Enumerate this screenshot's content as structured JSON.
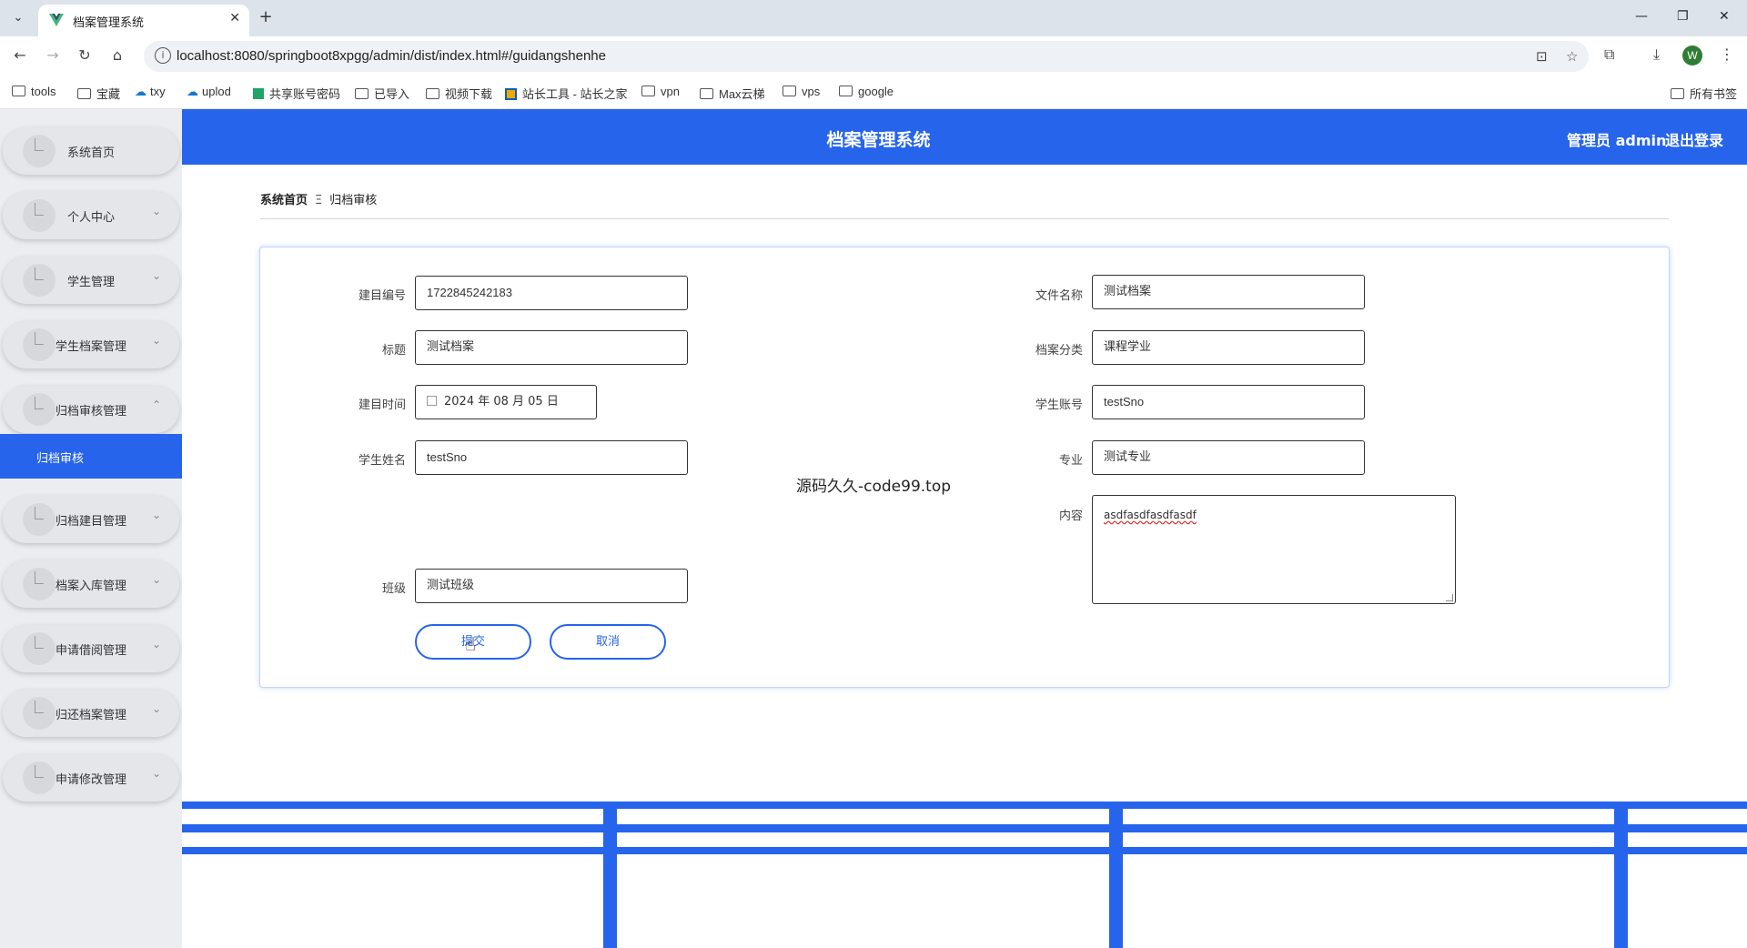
{
  "browser": {
    "tab_title": "档案管理系统",
    "url": "localhost:8080/springboot8xpgg/admin/dist/index.html#/guidangshenhe",
    "profile_initial": "W",
    "bookmarks": [
      "tools",
      "宝藏",
      "txy",
      "uplod",
      "共享账号密码",
      "已导入",
      "视频下载",
      "站长工具 - 站长之家",
      "vpn",
      "Max云梯",
      "vps",
      "google"
    ],
    "all_bookmarks": "所有书签"
  },
  "header": {
    "title": "档案管理系统",
    "admin_label": "管理员 admin",
    "logout_label": "退出登录"
  },
  "sidebar": {
    "items": [
      "系统首页",
      "个人中心",
      "学生管理",
      "学生档案管理",
      "归档审核管理",
      "归档建目管理",
      "档案入库管理",
      "申请借阅管理",
      "归还档案管理",
      "申请修改管理"
    ],
    "active_sub": "归档审核"
  },
  "breadcrumb": {
    "home": "系统首页",
    "separator": "Ξ",
    "current": "归档审核"
  },
  "form": {
    "catalog_no_label": "建目编号",
    "catalog_no": "1722845242183",
    "title_label": "标题",
    "title": "测试档案",
    "catalog_time_label": "建目时间",
    "catalog_time": "2024 年 08 月 05 日",
    "student_name_label": "学生姓名",
    "student_name": "testSno",
    "class_label": "班级",
    "class": "测试班级",
    "file_name_label": "文件名称",
    "file_name": "测试档案",
    "category_label": "档案分类",
    "category": "课程学业",
    "student_account_label": "学生账号",
    "student_account": "testSno",
    "major_label": "专业",
    "major": "测试专业",
    "content_label": "内容",
    "content": "asdfasdfasdfasdf",
    "submit_label": "提交",
    "cancel_label": "取消"
  },
  "watermark": "源码久久-code99.top"
}
